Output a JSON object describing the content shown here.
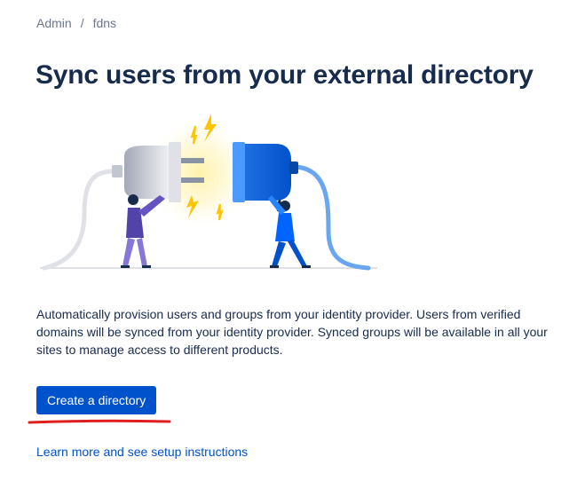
{
  "breadcrumb": {
    "items": [
      "Admin",
      "fdns"
    ],
    "separator": "/"
  },
  "page": {
    "title": "Sync users from your external directory",
    "description": "Automatically provision users and groups from your identity provider. Users from verified domains will be synced from your identity provider. Synced groups will be available in all your sites to manage access to different products.",
    "primary_button": "Create a directory",
    "learn_more_link": "Learn more and see setup instructions"
  },
  "illustration": {
    "icon": "plug-connection-illustration"
  },
  "colors": {
    "primary": "#0052cc",
    "text": "#172b4d",
    "subtle_text": "#6b778c",
    "annotation": "#e01e1e"
  }
}
